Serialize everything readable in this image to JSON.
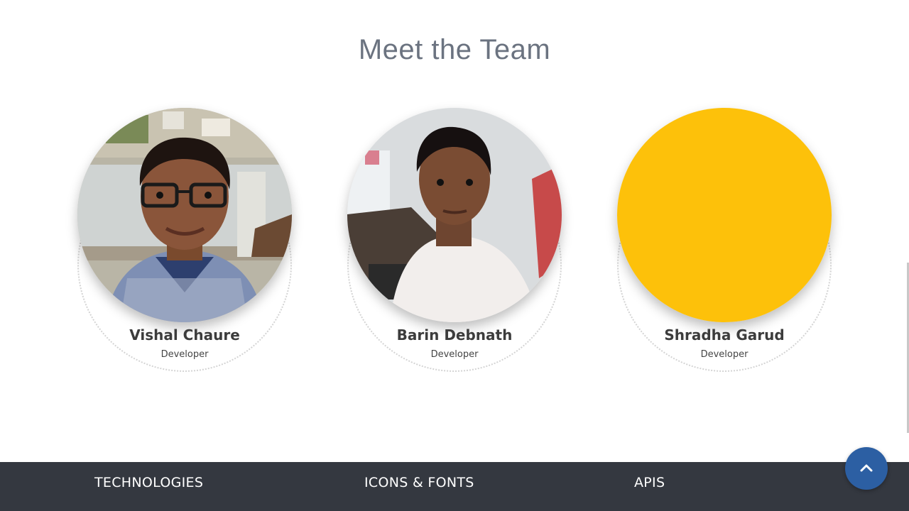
{
  "section": {
    "title": "Meet the Team"
  },
  "team": [
    {
      "name": "Vishal Chaure",
      "role": "Developer"
    },
    {
      "name": "Barin Debnath",
      "role": "Developer"
    },
    {
      "name": "Shradha Garud",
      "role": "Developer"
    }
  ],
  "footer": {
    "headings": [
      "TECHNOLOGIES",
      "ICONS & FONTS",
      "APIS"
    ]
  },
  "scroll_top": {
    "icon": "chevron-up-icon"
  },
  "colors": {
    "title": "#6b7380",
    "footer_bg": "#343840",
    "scroll_top_bg": "#2c5fa3",
    "placeholder_avatar": "#fdc10a"
  }
}
